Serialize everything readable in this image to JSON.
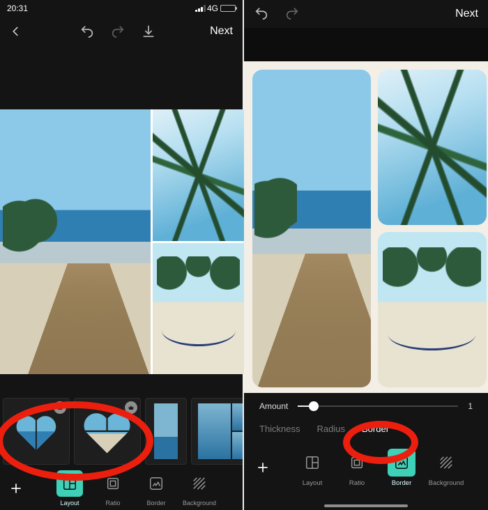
{
  "screenA": {
    "status": {
      "time": "20:31",
      "network": "4G"
    },
    "topnav": {
      "next": "Next"
    },
    "toolbar": {
      "items": [
        {
          "key": "layout",
          "label": "Layout"
        },
        {
          "key": "ratio",
          "label": "Ratio"
        },
        {
          "key": "border",
          "label": "Border"
        },
        {
          "key": "background",
          "label": "Background"
        }
      ],
      "active": "layout"
    }
  },
  "screenB": {
    "topnav": {
      "next": "Next"
    },
    "slider": {
      "label": "Amount",
      "value": 1,
      "min": 0,
      "max": 10,
      "display": "1"
    },
    "suboptions": {
      "items": [
        {
          "key": "thickness",
          "label": "Thickness"
        },
        {
          "key": "radius",
          "label": "Radius"
        },
        {
          "key": "border",
          "label": "Border"
        }
      ],
      "active": "border"
    },
    "toolbar": {
      "items": [
        {
          "key": "layout",
          "label": "Layout"
        },
        {
          "key": "ratio",
          "label": "Ratio"
        },
        {
          "key": "border",
          "label": "Border"
        },
        {
          "key": "background",
          "label": "Background"
        }
      ],
      "active": "border"
    }
  }
}
